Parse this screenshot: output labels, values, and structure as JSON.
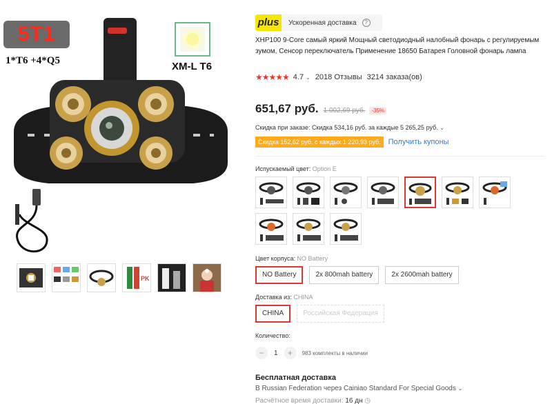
{
  "gallery": {
    "badge": "5T1",
    "sub_label": "1*T6 +4*Q5",
    "led_label": "XM-L T6",
    "thumbnails": [
      "case-kit",
      "color-options",
      "headband",
      "battery-pk",
      "light-beam",
      "user-photo"
    ]
  },
  "delivery_badge": {
    "plus": "plus",
    "text": "Ускоренная доставка",
    "help": "?"
  },
  "product": {
    "title": "XHP100 9-Core самый яркий Мощный светодиодный налобный фонарь с регулируемым зумом, Сенсор переключатель Применение 18650 Батарея Головной фонарь лампа",
    "stars": "★★★★★",
    "rating": "4.7",
    "reviews": "2018 Отзывы",
    "orders": "3214 заказа(ов)"
  },
  "price": {
    "current": "651,67 руб.",
    "old": "1 002,69 руб.",
    "discount": "-35%",
    "extra_discount": "Скидка при заказе: Скидка 534,16 руб. за каждые 5 265,25 руб.",
    "coupon_tag": "Скидка 152,62 руб. с каждых 1 220,93 руб.",
    "coupon_link": "Получить купоны"
  },
  "color": {
    "label": "Испускаемый цвет:",
    "selected": "Option E",
    "swatch_count": 10
  },
  "body_color": {
    "label": "Цвет корпуса:",
    "selected": "NO Battery",
    "options": [
      "NO Battery",
      "2x 800mah battery",
      "2x 2600mah battery"
    ]
  },
  "ship_from": {
    "label": "Доставка из:",
    "selected": "CHINA",
    "options": [
      "CHINA",
      "Российская Федерация"
    ]
  },
  "quantity": {
    "label": "Количество:",
    "value": "1",
    "minus": "−",
    "plus": "+",
    "stock": "983 комплекты в наличии"
  },
  "shipping": {
    "title": "Бесплатная доставка",
    "line": "В Russian Federation через Cainiao Standard For Special Goods",
    "time_label": "Расчётное время доставки:",
    "time_value": "16 дн"
  },
  "colors": {
    "accent": "#e0362f",
    "plus_yellow": "#f7e600",
    "coupon_orange": "#ffaa1a",
    "link_blue": "#2e7adb"
  }
}
